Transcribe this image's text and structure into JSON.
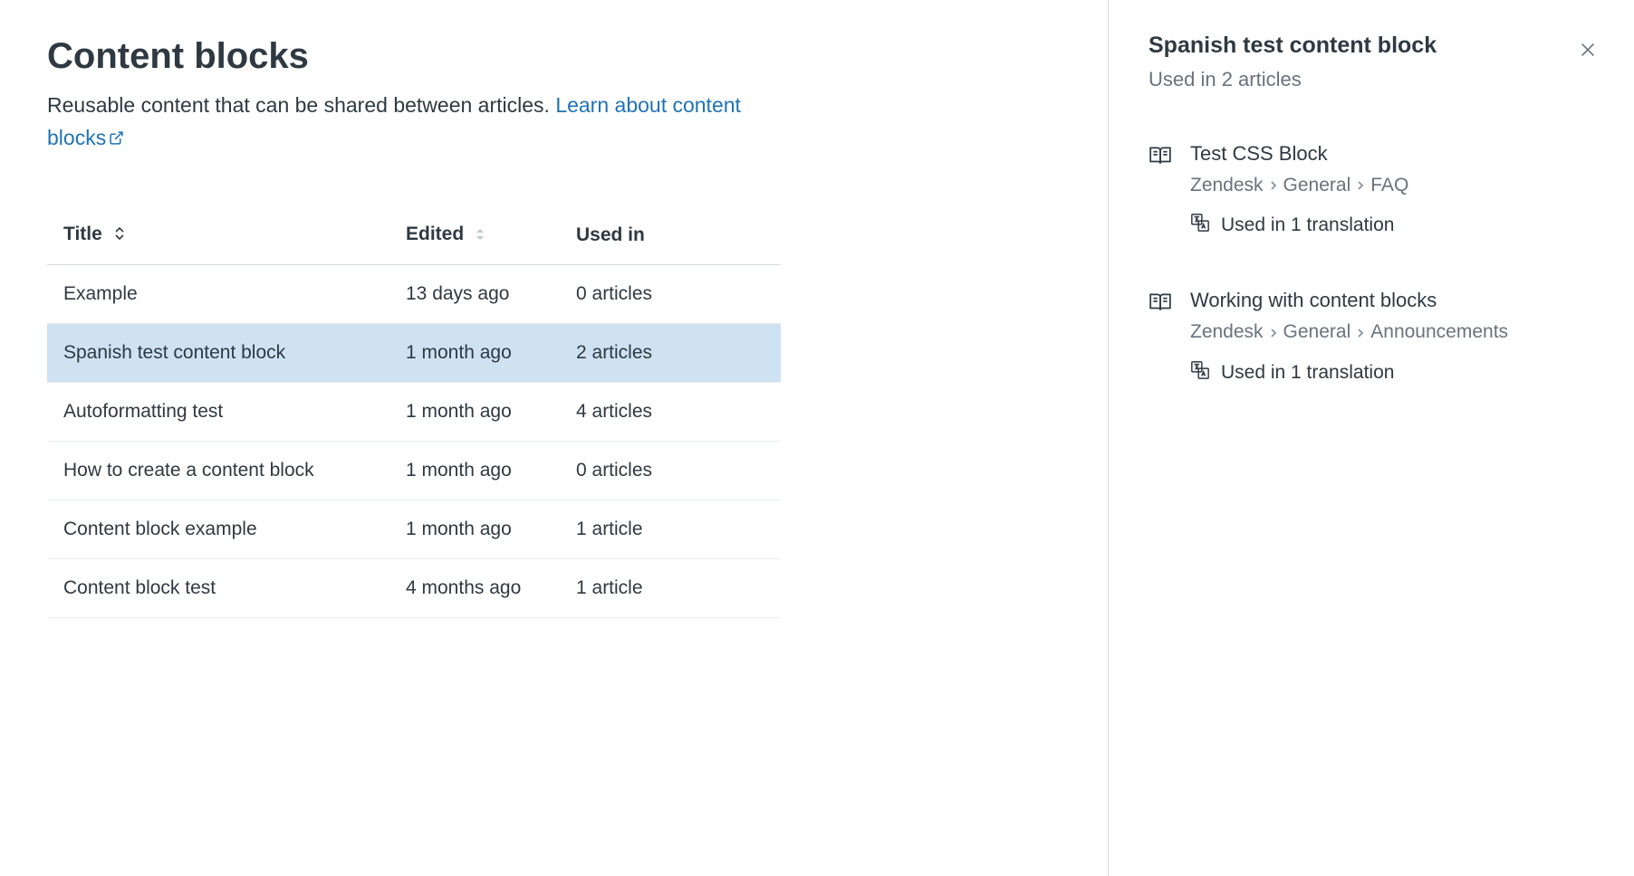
{
  "header": {
    "title": "Content blocks",
    "description_text": "Reusable content that can be shared between articles. ",
    "link_text": "Learn about content blocks"
  },
  "table": {
    "columns": {
      "title": "Title",
      "edited": "Edited",
      "used_in": "Used in"
    },
    "rows": [
      {
        "title": "Example",
        "edited": "13 days ago",
        "used_in": "0 articles",
        "selected": false
      },
      {
        "title": "Spanish test content block",
        "edited": "1 month ago",
        "used_in": "2 articles",
        "selected": true
      },
      {
        "title": "Autoformatting test",
        "edited": "1 month ago",
        "used_in": "4 articles",
        "selected": false
      },
      {
        "title": "How to create a content block",
        "edited": "1 month ago",
        "used_in": "0 articles",
        "selected": false
      },
      {
        "title": "Content block example",
        "edited": "1 month ago",
        "used_in": "1 article",
        "selected": false
      },
      {
        "title": "Content block test",
        "edited": "4 months ago",
        "used_in": "1 article",
        "selected": false
      }
    ]
  },
  "panel": {
    "title": "Spanish test content block",
    "subtitle": "Used in 2 articles",
    "articles": [
      {
        "title": "Test CSS Block",
        "breadcrumb": [
          "Zendesk",
          "General",
          "FAQ"
        ],
        "translation_text": "Used in 1 translation"
      },
      {
        "title": "Working with content blocks",
        "breadcrumb": [
          "Zendesk",
          "General",
          "Announcements"
        ],
        "translation_text": "Used in 1 translation"
      }
    ]
  }
}
